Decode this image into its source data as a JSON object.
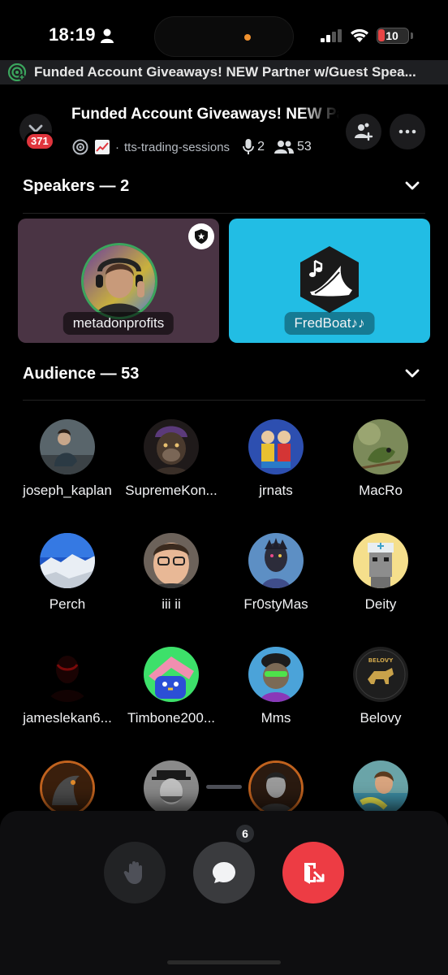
{
  "status_bar": {
    "time": "18:19",
    "battery": "10",
    "icons": [
      "person-icon",
      "signal-icon",
      "wifi-icon",
      "battery-icon"
    ],
    "colors": {
      "battery_low": "#e84545",
      "privacy_dot": "#f0912f"
    }
  },
  "banner": {
    "icon": "stage-live-icon",
    "text": "Funded Account Giveaways! NEW Partner w/Guest Spea..."
  },
  "header": {
    "notification_count": "371",
    "title": "Funded Account Giveaways! NEW Partner",
    "channel_separator": "·",
    "channel": "tts-trading-sessions",
    "speaker_count": "2",
    "listener_count": "53",
    "icons": [
      "stage-icon",
      "chart-icon",
      "microphone-icon",
      "people-icon",
      "invite-icon",
      "more-icon"
    ]
  },
  "speakers_section": {
    "title": "Speakers — 2"
  },
  "speakers": [
    {
      "name": "metadonprofits",
      "moderator": true,
      "speaking": true,
      "tile_color": "#4a3444"
    },
    {
      "name": "FredBoat♪♪",
      "moderator": false,
      "speaking": false,
      "tile_color": "#22bde4"
    }
  ],
  "audience_section": {
    "title": "Audience — 53"
  },
  "audience": [
    {
      "name": "joseph_kaplan"
    },
    {
      "name": "SupremeKon..."
    },
    {
      "name": "jrnats"
    },
    {
      "name": "MacRo"
    },
    {
      "name": "Perch"
    },
    {
      "name": "iii ii"
    },
    {
      "name": "Fr0styMas"
    },
    {
      "name": "Deity"
    },
    {
      "name": "jameslekan6..."
    },
    {
      "name": "Timbone200..."
    },
    {
      "name": "Mms"
    },
    {
      "name": "Belovy"
    },
    {
      "name": ""
    },
    {
      "name": ""
    },
    {
      "name": ""
    },
    {
      "name": ""
    }
  ],
  "belovy_logo_text": "BELOVY",
  "controls": {
    "chat_unread": "6",
    "buttons": [
      "raise-hand",
      "chat",
      "leave-stage"
    ],
    "colors": {
      "leave": "#ed3c44",
      "speaking_ring": "#3ba55d"
    }
  }
}
